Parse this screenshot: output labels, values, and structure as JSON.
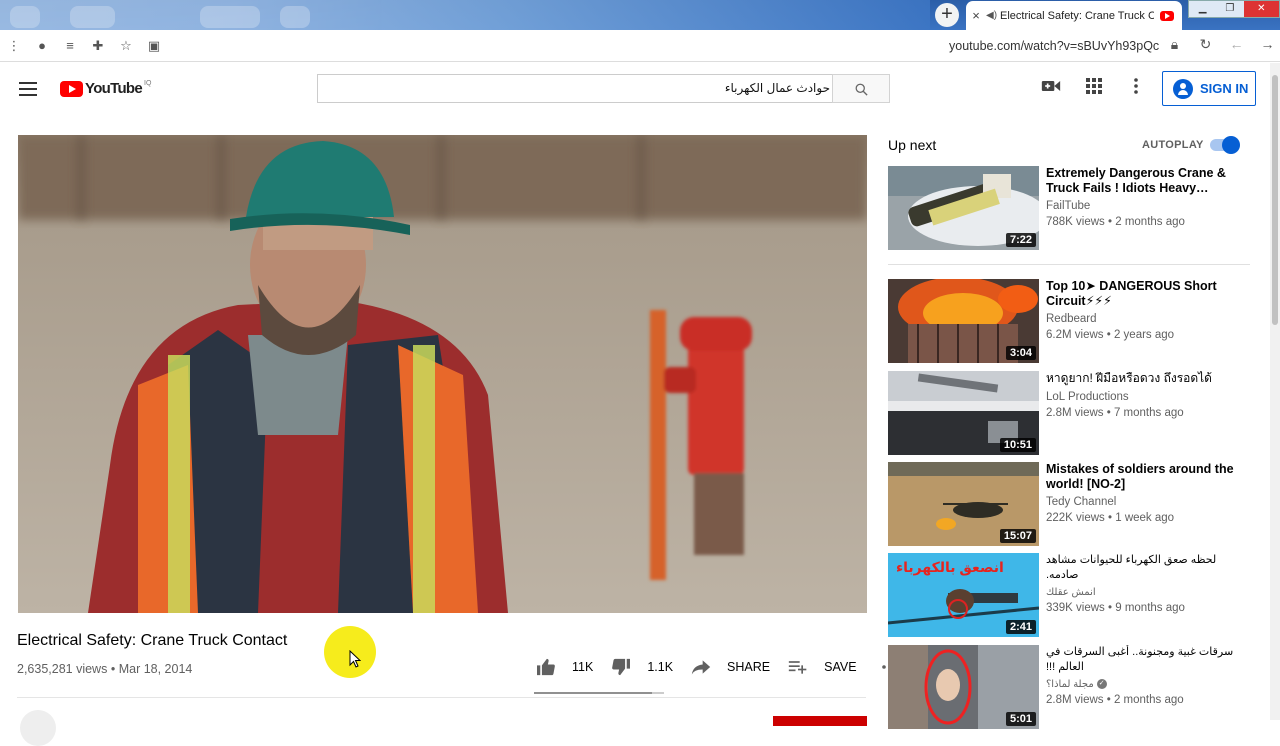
{
  "browser": {
    "tab_title": "Electrical Safety: Crane Truck Contact",
    "url": "youtube.com/watch?v=sBUvYh93pQc",
    "new_tab_label": "+",
    "close_tab_glyph": "×"
  },
  "header": {
    "logo_text": "YouTube",
    "logo_country": "IQ",
    "search_value": "حوادث عمال الكهرباء",
    "sign_in_label": "SIGN IN"
  },
  "video": {
    "title": "Electrical Safety: Crane Truck Contact",
    "views": "2,635,281 views",
    "date": "Mar 18, 2014",
    "meta_separator": "•",
    "likes": "11K",
    "dislikes": "1.1K",
    "share_label": "SHARE",
    "save_label": "SAVE",
    "like_ratio": 0.91
  },
  "sidebar": {
    "up_next_label": "Up next",
    "autoplay_label": "AUTOPLAY",
    "autoplay_on": true,
    "items": [
      {
        "title": "Extremely Dangerous Crane & Truck Fails ! Idiots Heavy…",
        "channel": "FailTube",
        "views": "788K views",
        "age": "2 months ago",
        "duration": "7:22",
        "verified": false,
        "rtl": false
      },
      {
        "title": "Top 10➤ DANGEROUS Short Circuit⚡⚡⚡",
        "channel": "Redbeard",
        "views": "6.2M views",
        "age": "2 years ago",
        "duration": "3:04",
        "verified": false,
        "rtl": false
      },
      {
        "title": "หาดูยาก! ฝีมือหรือดวง ถึงรอดได้",
        "channel": "LoL Productions",
        "views": "2.8M views",
        "age": "7 months ago",
        "duration": "10:51",
        "verified": false,
        "rtl": false
      },
      {
        "title": "Mistakes of soldiers around the world! [NO-2]",
        "channel": "Tedy Channel",
        "views": "222K views",
        "age": "1 week ago",
        "duration": "15:07",
        "verified": false,
        "rtl": false
      },
      {
        "title": "لحظه صعق الكهرباء للحيوانات مشاهد صادمه.",
        "channel": "انمش عقلك",
        "views": "339K views",
        "age": "9 months ago",
        "duration": "2:41",
        "verified": false,
        "rtl": true,
        "thumb_text": "انصعق بالكهرباء"
      },
      {
        "title": "سرقات غبية ومجنونة.. أغبى السرقات في العالم !!!",
        "channel": "مجلة لماذا؟",
        "views": "2.8M views",
        "age": "2 months ago",
        "duration": "5:01",
        "verified": true,
        "rtl": true
      }
    ]
  },
  "colors": {
    "accent": "#065fd4",
    "youtube_red": "#ff0000",
    "cursor_highlight": "#f6ec1c"
  },
  "icons": [
    "menu-icon",
    "search-icon",
    "video-camera-icon",
    "apps-icon",
    "more-vert-icon",
    "thumbs-up-icon",
    "thumbs-down-icon",
    "share-icon",
    "playlist-add-icon",
    "more-horiz-icon"
  ]
}
